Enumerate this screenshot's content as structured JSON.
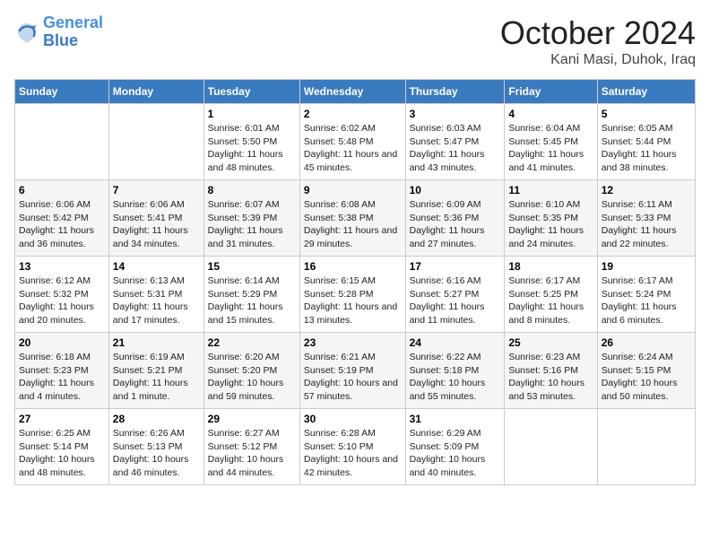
{
  "logo": {
    "line1": "General",
    "line2": "Blue"
  },
  "title": "October 2024",
  "location": "Kani Masi, Duhok, Iraq",
  "weekdays": [
    "Sunday",
    "Monday",
    "Tuesday",
    "Wednesday",
    "Thursday",
    "Friday",
    "Saturday"
  ],
  "weeks": [
    [
      null,
      null,
      {
        "day": 1,
        "sunrise": "6:01 AM",
        "sunset": "5:50 PM",
        "daylight": "11 hours and 48 minutes."
      },
      {
        "day": 2,
        "sunrise": "6:02 AM",
        "sunset": "5:48 PM",
        "daylight": "11 hours and 45 minutes."
      },
      {
        "day": 3,
        "sunrise": "6:03 AM",
        "sunset": "5:47 PM",
        "daylight": "11 hours and 43 minutes."
      },
      {
        "day": 4,
        "sunrise": "6:04 AM",
        "sunset": "5:45 PM",
        "daylight": "11 hours and 41 minutes."
      },
      {
        "day": 5,
        "sunrise": "6:05 AM",
        "sunset": "5:44 PM",
        "daylight": "11 hours and 38 minutes."
      }
    ],
    [
      {
        "day": 6,
        "sunrise": "6:06 AM",
        "sunset": "5:42 PM",
        "daylight": "11 hours and 36 minutes."
      },
      {
        "day": 7,
        "sunrise": "6:06 AM",
        "sunset": "5:41 PM",
        "daylight": "11 hours and 34 minutes."
      },
      {
        "day": 8,
        "sunrise": "6:07 AM",
        "sunset": "5:39 PM",
        "daylight": "11 hours and 31 minutes."
      },
      {
        "day": 9,
        "sunrise": "6:08 AM",
        "sunset": "5:38 PM",
        "daylight": "11 hours and 29 minutes."
      },
      {
        "day": 10,
        "sunrise": "6:09 AM",
        "sunset": "5:36 PM",
        "daylight": "11 hours and 27 minutes."
      },
      {
        "day": 11,
        "sunrise": "6:10 AM",
        "sunset": "5:35 PM",
        "daylight": "11 hours and 24 minutes."
      },
      {
        "day": 12,
        "sunrise": "6:11 AM",
        "sunset": "5:33 PM",
        "daylight": "11 hours and 22 minutes."
      }
    ],
    [
      {
        "day": 13,
        "sunrise": "6:12 AM",
        "sunset": "5:32 PM",
        "daylight": "11 hours and 20 minutes."
      },
      {
        "day": 14,
        "sunrise": "6:13 AM",
        "sunset": "5:31 PM",
        "daylight": "11 hours and 17 minutes."
      },
      {
        "day": 15,
        "sunrise": "6:14 AM",
        "sunset": "5:29 PM",
        "daylight": "11 hours and 15 minutes."
      },
      {
        "day": 16,
        "sunrise": "6:15 AM",
        "sunset": "5:28 PM",
        "daylight": "11 hours and 13 minutes."
      },
      {
        "day": 17,
        "sunrise": "6:16 AM",
        "sunset": "5:27 PM",
        "daylight": "11 hours and 11 minutes."
      },
      {
        "day": 18,
        "sunrise": "6:17 AM",
        "sunset": "5:25 PM",
        "daylight": "11 hours and 8 minutes."
      },
      {
        "day": 19,
        "sunrise": "6:17 AM",
        "sunset": "5:24 PM",
        "daylight": "11 hours and 6 minutes."
      }
    ],
    [
      {
        "day": 20,
        "sunrise": "6:18 AM",
        "sunset": "5:23 PM",
        "daylight": "11 hours and 4 minutes."
      },
      {
        "day": 21,
        "sunrise": "6:19 AM",
        "sunset": "5:21 PM",
        "daylight": "11 hours and 1 minute."
      },
      {
        "day": 22,
        "sunrise": "6:20 AM",
        "sunset": "5:20 PM",
        "daylight": "10 hours and 59 minutes."
      },
      {
        "day": 23,
        "sunrise": "6:21 AM",
        "sunset": "5:19 PM",
        "daylight": "10 hours and 57 minutes."
      },
      {
        "day": 24,
        "sunrise": "6:22 AM",
        "sunset": "5:18 PM",
        "daylight": "10 hours and 55 minutes."
      },
      {
        "day": 25,
        "sunrise": "6:23 AM",
        "sunset": "5:16 PM",
        "daylight": "10 hours and 53 minutes."
      },
      {
        "day": 26,
        "sunrise": "6:24 AM",
        "sunset": "5:15 PM",
        "daylight": "10 hours and 50 minutes."
      }
    ],
    [
      {
        "day": 27,
        "sunrise": "6:25 AM",
        "sunset": "5:14 PM",
        "daylight": "10 hours and 48 minutes."
      },
      {
        "day": 28,
        "sunrise": "6:26 AM",
        "sunset": "5:13 PM",
        "daylight": "10 hours and 46 minutes."
      },
      {
        "day": 29,
        "sunrise": "6:27 AM",
        "sunset": "5:12 PM",
        "daylight": "10 hours and 44 minutes."
      },
      {
        "day": 30,
        "sunrise": "6:28 AM",
        "sunset": "5:10 PM",
        "daylight": "10 hours and 42 minutes."
      },
      {
        "day": 31,
        "sunrise": "6:29 AM",
        "sunset": "5:09 PM",
        "daylight": "10 hours and 40 minutes."
      },
      null,
      null
    ]
  ]
}
